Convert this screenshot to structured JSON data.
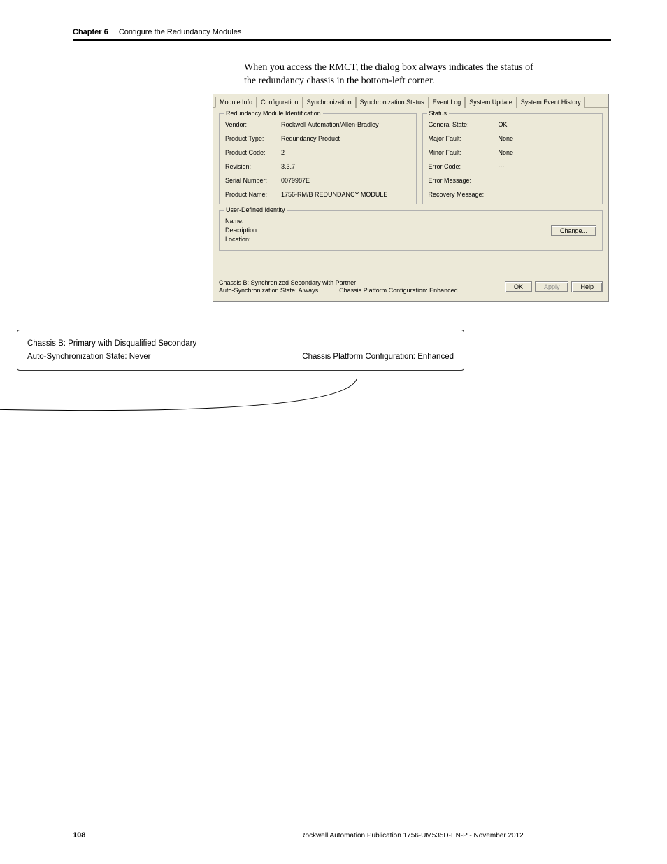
{
  "header": {
    "chapter_num": "Chapter 6",
    "chapter_title": "Configure the Redundancy Modules"
  },
  "intro_paragraph": "When you access the RMCT, the dialog box always indicates the status of the redundancy chassis in the bottom-left corner.",
  "dialog": {
    "tabs": [
      "Module Info",
      "Configuration",
      "Synchronization",
      "Synchronization Status",
      "Event Log",
      "System Update",
      "System Event History"
    ],
    "active_tab": "Module Info",
    "identification": {
      "legend": "Redundancy Module Identification",
      "vendor_label": "Vendor:",
      "vendor_value": "Rockwell Automation/Allen-Bradley",
      "product_type_label": "Product Type:",
      "product_type_value": "Redundancy Product",
      "product_code_label": "Product Code:",
      "product_code_value": "2",
      "revision_label": "Revision:",
      "revision_value": "3.3.7",
      "serial_label": "Serial Number:",
      "serial_value": "0079987E",
      "product_name_label": "Product Name:",
      "product_name_value": "1756-RM/B REDUNDANCY MODULE"
    },
    "status": {
      "legend": "Status",
      "general_state_label": "General State:",
      "general_state_value": "OK",
      "major_fault_label": "Major Fault:",
      "major_fault_value": "None",
      "minor_fault_label": "Minor Fault:",
      "minor_fault_value": "None",
      "error_code_label": "Error Code:",
      "error_code_value": "---",
      "error_message_label": "Error Message:",
      "error_message_value": "",
      "recovery_message_label": "Recovery Message:",
      "recovery_message_value": ""
    },
    "user_identity": {
      "legend": "User-Defined Identity",
      "name_label": "Name:",
      "description_label": "Description:",
      "location_label": "Location:",
      "change_btn": "Change..."
    },
    "bottom_status": {
      "line1": "Chassis B: Synchronized Secondary with Partner",
      "line2_left": "Auto-Synchronization State:  Always",
      "line2_right": "Chassis Platform Configuration:  Enhanced"
    },
    "buttons": {
      "ok": "OK",
      "apply": "Apply",
      "help": "Help"
    }
  },
  "callout": {
    "line1": "Chassis B: Primary with Disqualified Secondary",
    "line2_left": "Auto-Synchronization State:  Never",
    "line2_right": "Chassis Platform Configuration:  Enhanced"
  },
  "footer": {
    "page_num": "108",
    "pub_info": "Rockwell Automation Publication 1756-UM535D-EN-P - November 2012"
  }
}
